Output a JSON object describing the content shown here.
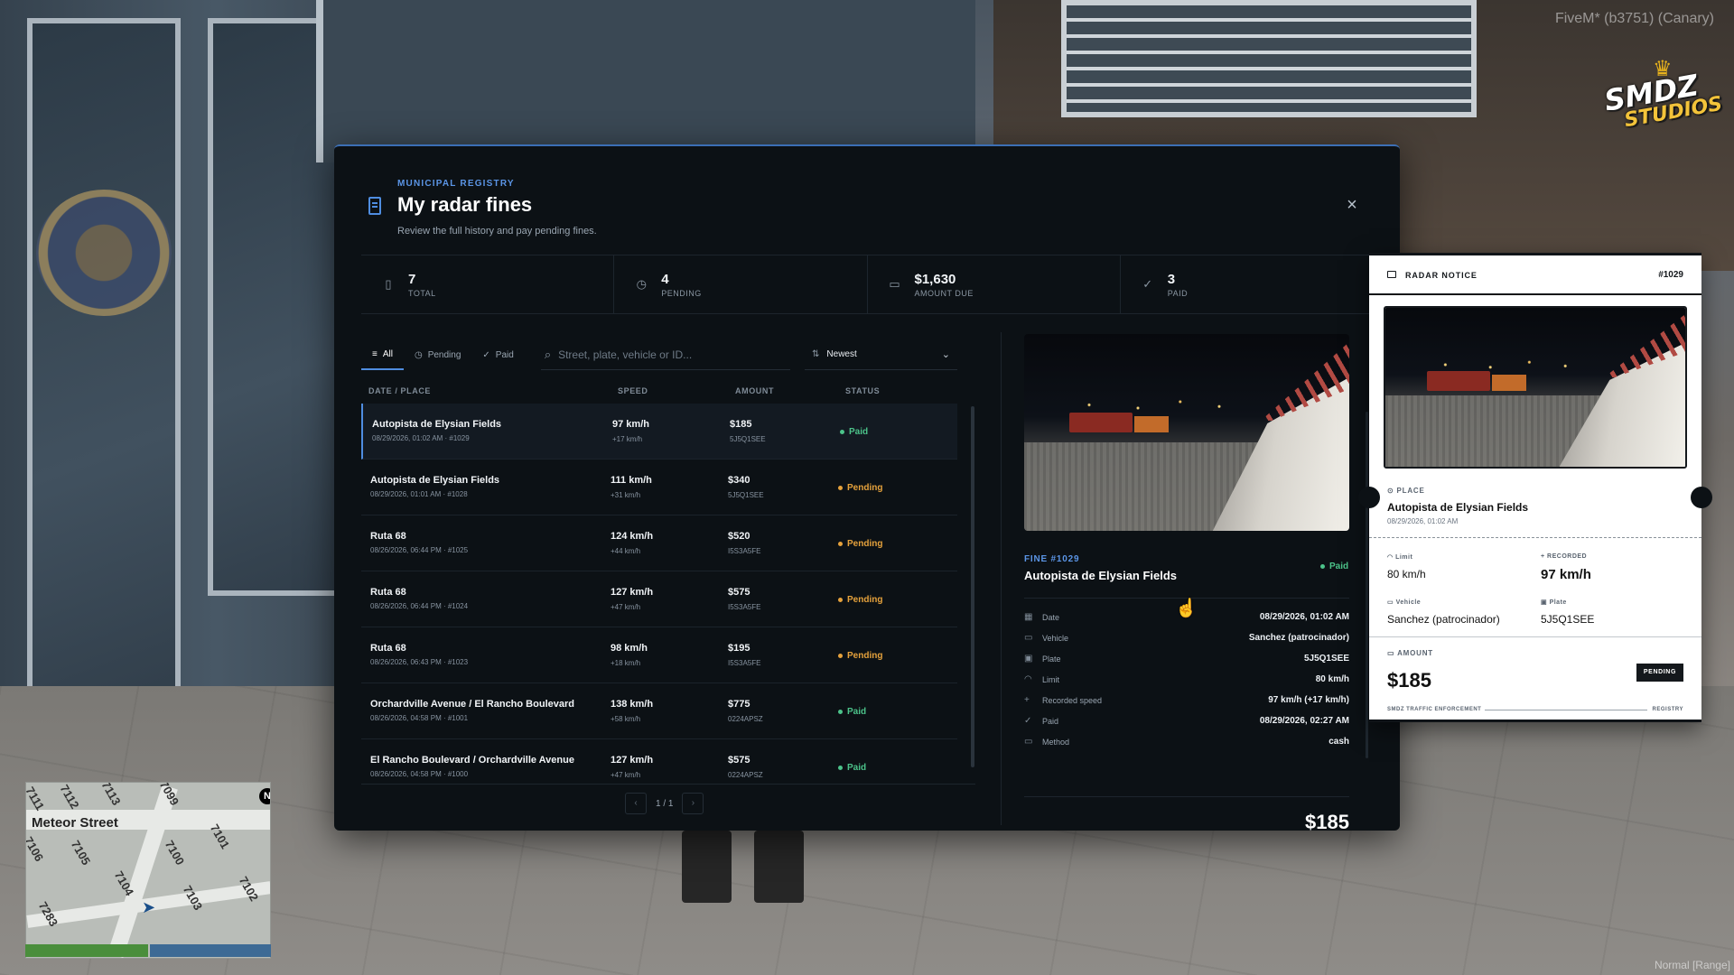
{
  "overlay": {
    "build_label": "FiveM* (b3751) (Canary)",
    "logo_text_1": "SMDZ",
    "logo_text_2": "STUDIOS",
    "mode_label": "Normal [Range]"
  },
  "minimap": {
    "street": "Meteor Street",
    "numbers": [
      "7111",
      "7112",
      "7113",
      "7099",
      "7101",
      "7100",
      "7105",
      "7104",
      "7106",
      "7103",
      "7102",
      "7283"
    ],
    "north": "N",
    "health_fraction": 0.5
  },
  "modal": {
    "eyebrow": "MUNICIPAL REGISTRY",
    "title": "My radar fines",
    "subtitle": "Review the full history and pay pending fines.",
    "close_icon": "close-icon"
  },
  "stats": [
    {
      "value": "7",
      "label": "TOTAL",
      "icon": "document-icon"
    },
    {
      "value": "4",
      "label": "PENDING",
      "icon": "clock-icon"
    },
    {
      "value": "$1,630",
      "label": "AMOUNT DUE",
      "icon": "card-icon"
    },
    {
      "value": "3",
      "label": "PAID",
      "icon": "check-circle-icon"
    }
  ],
  "filters": {
    "tabs": [
      {
        "label": "All",
        "icon": "list-icon",
        "active": true
      },
      {
        "label": "Pending",
        "icon": "clock-icon",
        "active": false
      },
      {
        "label": "Paid",
        "icon": "check-icon",
        "active": false
      }
    ],
    "search_placeholder": "Street, plate, vehicle or ID...",
    "sort_value": "Newest"
  },
  "table": {
    "headers": {
      "date_place": "DATE / PLACE",
      "speed": "SPEED",
      "amount": "AMOUNT",
      "status": "STATUS"
    },
    "rows": [
      {
        "place": "Autopista de Elysian Fields",
        "meta": "08/29/2026, 01:02 AM · #1029",
        "speed": "97 km/h",
        "over": "+17 km/h",
        "amount": "$185",
        "plate": "5J5Q1SEE",
        "status": "Paid"
      },
      {
        "place": "Autopista de Elysian Fields",
        "meta": "08/29/2026, 01:01 AM · #1028",
        "speed": "111 km/h",
        "over": "+31 km/h",
        "amount": "$340",
        "plate": "5J5Q1SEE",
        "status": "Pending"
      },
      {
        "place": "Ruta 68",
        "meta": "08/26/2026, 06:44 PM · #1025",
        "speed": "124 km/h",
        "over": "+44 km/h",
        "amount": "$520",
        "plate": "I5S3A5FE",
        "status": "Pending"
      },
      {
        "place": "Ruta 68",
        "meta": "08/26/2026, 06:44 PM · #1024",
        "speed": "127 km/h",
        "over": "+47 km/h",
        "amount": "$575",
        "plate": "I5S3A5FE",
        "status": "Pending"
      },
      {
        "place": "Ruta 68",
        "meta": "08/26/2026, 06:43 PM · #1023",
        "speed": "98 km/h",
        "over": "+18 km/h",
        "amount": "$195",
        "plate": "I5S3A5FE",
        "status": "Pending"
      },
      {
        "place": "Orchardville Avenue / El Rancho Boulevard",
        "meta": "08/26/2026, 04:58 PM · #1001",
        "speed": "138 km/h",
        "over": "+58 km/h",
        "amount": "$775",
        "plate": "0224APSZ",
        "status": "Paid"
      },
      {
        "place": "El Rancho Boulevard / Orchardville Avenue",
        "meta": "08/26/2026, 04:58 PM · #1000",
        "speed": "127 km/h",
        "over": "+47 km/h",
        "amount": "$575",
        "plate": "0224APSZ",
        "status": "Paid"
      }
    ]
  },
  "pager": {
    "label": "1 / 1",
    "prev_icon": "chevron-left-icon",
    "next_icon": "chevron-right-icon"
  },
  "detail": {
    "fine_no": "FINE #1029",
    "place": "Autopista de Elysian Fields",
    "status": "Paid",
    "fields": [
      {
        "key": "Date",
        "value": "08/29/2026, 01:02 AM",
        "icon": "calendar-icon"
      },
      {
        "key": "Vehicle",
        "value": "Sanchez (patrocinador)",
        "icon": "car-icon"
      },
      {
        "key": "Plate",
        "value": "5J5Q1SEE",
        "icon": "plate-icon"
      },
      {
        "key": "Limit",
        "value": "80 km/h",
        "icon": "gauge-icon"
      },
      {
        "key": "Recorded speed",
        "value": "97 km/h (+17 km/h)",
        "icon": "plus-icon"
      },
      {
        "key": "Paid",
        "value": "08/29/2026, 02:27 AM",
        "icon": "check-icon"
      },
      {
        "key": "Method",
        "value": "cash",
        "icon": "card-icon"
      }
    ],
    "total": "$185"
  },
  "notice": {
    "title": "RADAR NOTICE",
    "number": "#1029",
    "place_label": "PLACE",
    "place": "Autopista de Elysian Fields",
    "date": "08/29/2026, 01:02 AM",
    "limit_label": "Limit",
    "limit": "80 km/h",
    "recorded_label": "RECORDED",
    "recorded": "97 km/h",
    "vehicle_label": "Vehicle",
    "vehicle": "Sanchez (patrocinador)",
    "plate_label": "Plate",
    "plate": "5J5Q1SEE",
    "amount_label": "AMOUNT",
    "amount": "$185",
    "badge": "PENDING",
    "footer_left": "SMDZ TRAFFIC ENFORCEMENT",
    "footer_right": "REGISTRY"
  },
  "colors": {
    "accent": "#4f8de0",
    "paid": "#4cc38a",
    "pending": "#e6a23c",
    "modal_bg": "#0c1115",
    "notice_bg": "#ffffff"
  }
}
